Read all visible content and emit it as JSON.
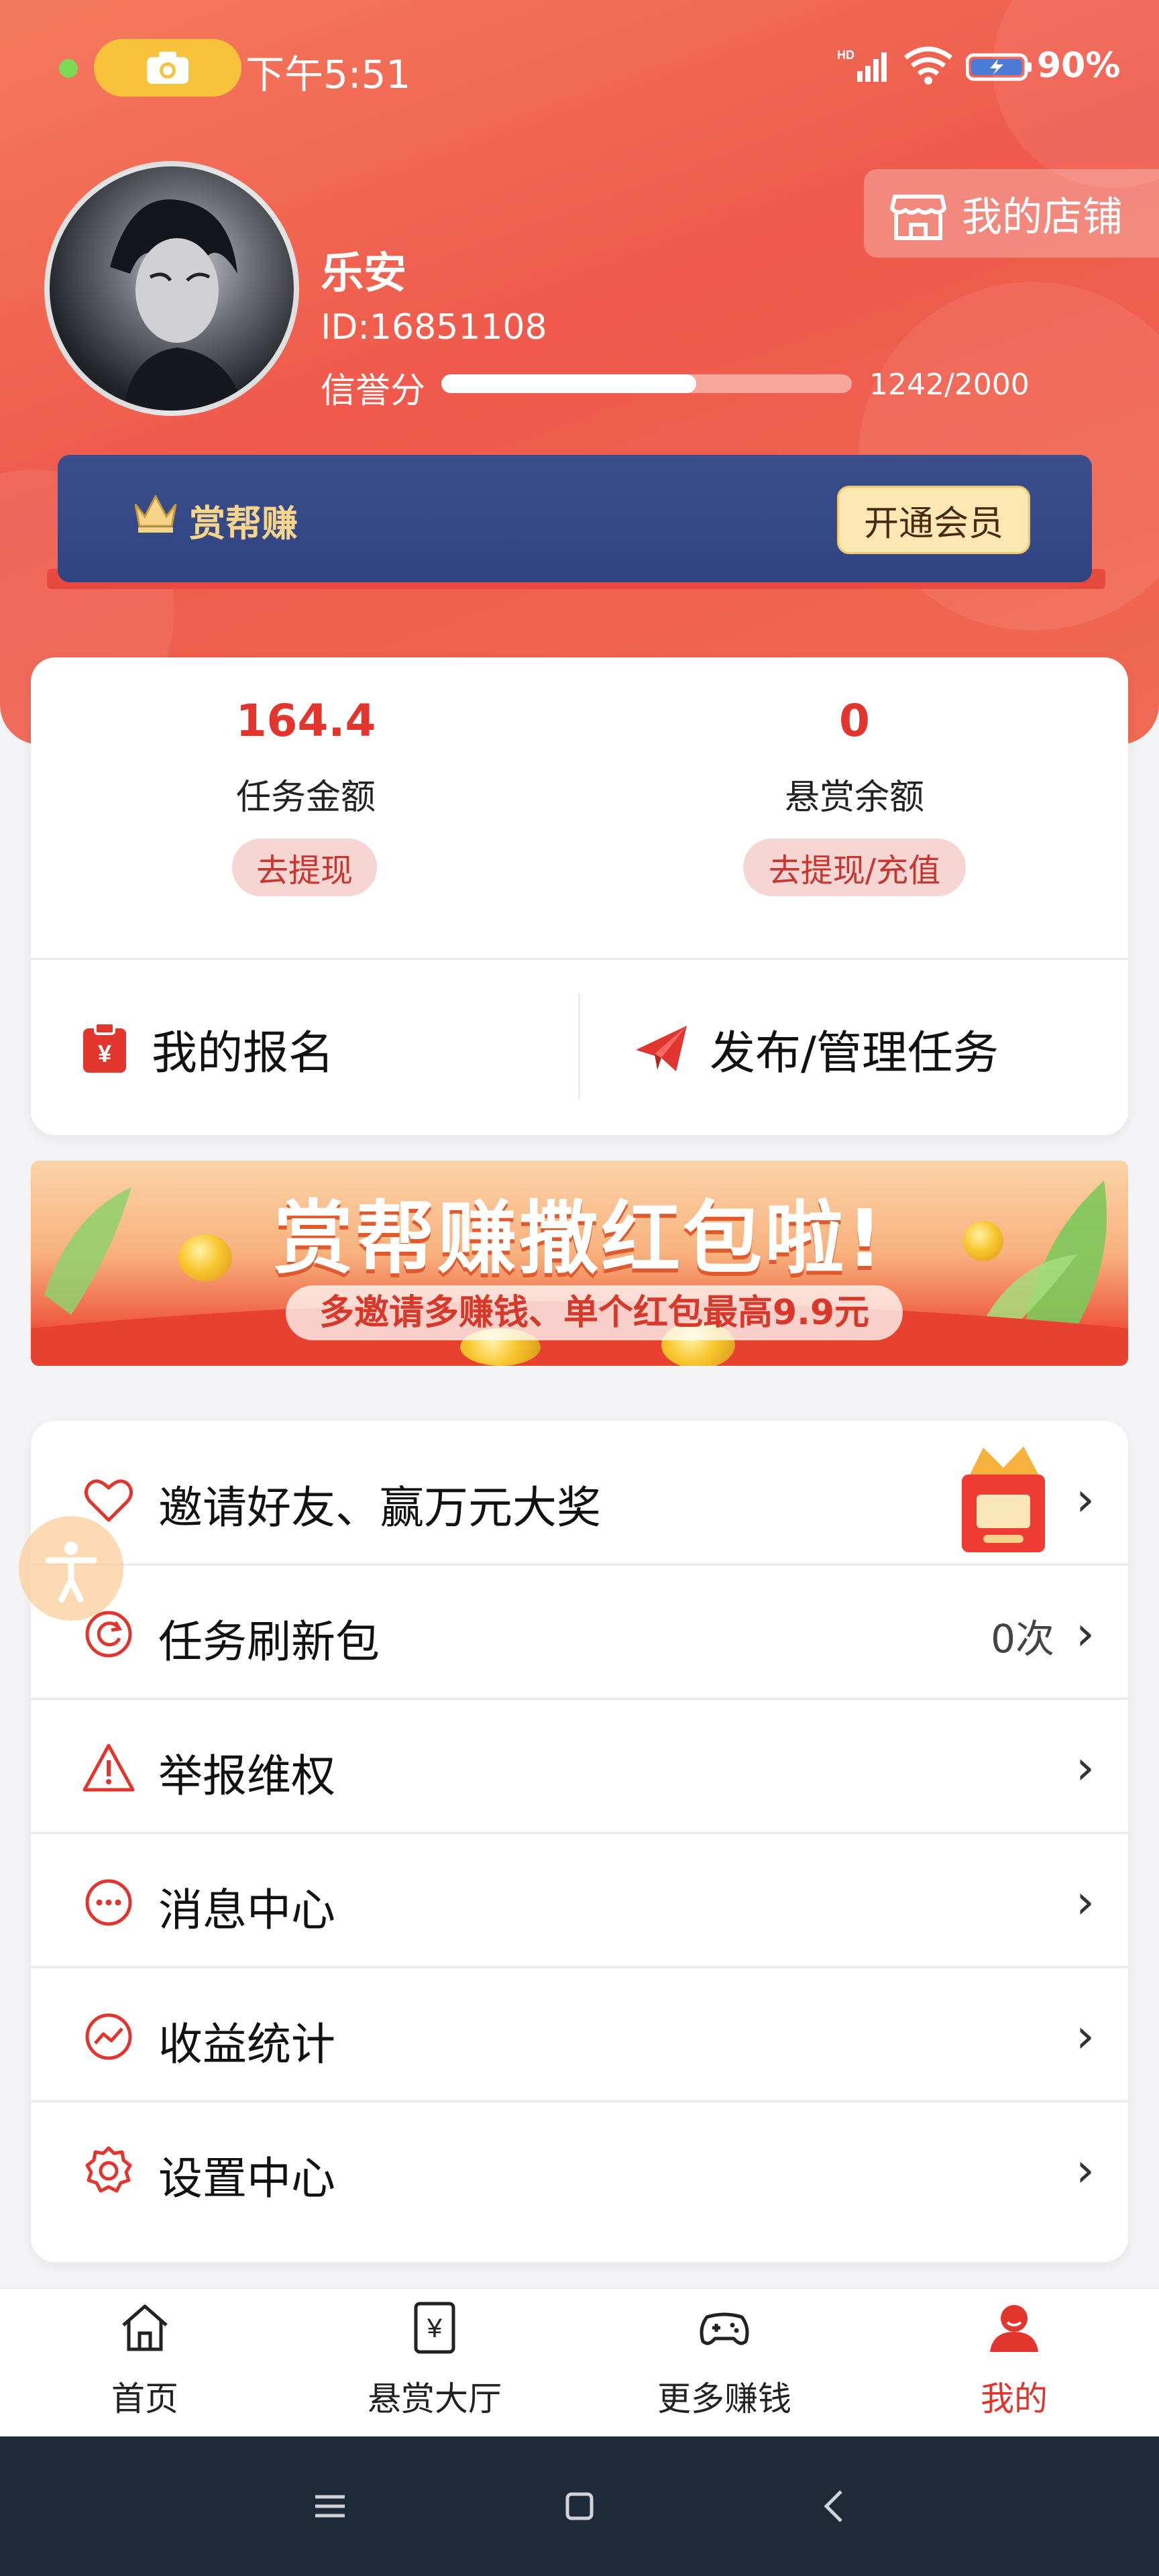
{
  "status_bar": {
    "time": "下午5:51",
    "network": "HD",
    "battery_pct": "90%"
  },
  "profile": {
    "name": "乐安",
    "id": "ID:16851108",
    "credit_label": "信誉分",
    "credit_value": "1242/2000",
    "credit_progress": 0.621,
    "shop_button": "我的店铺"
  },
  "vip": {
    "label": "赏帮赚",
    "button": "开通会员"
  },
  "wallet": {
    "task_amount": "164.4",
    "task_label": "任务金额",
    "task_action": "去提现",
    "reward_amount": "0",
    "reward_label": "悬赏余额",
    "reward_action": "去提现/充值"
  },
  "actions": {
    "my_signup": "我的报名",
    "publish_manage": "发布/管理任务"
  },
  "promo": {
    "title": "赏帮赚撒红包啦!",
    "subtitle": "多邀请多赚钱、单个红包最高9.9元"
  },
  "menu": [
    {
      "label": "邀请好友、赢万元大奖",
      "icon": "heart-icon",
      "extra": ""
    },
    {
      "label": "任务刷新包",
      "icon": "refresh-icon",
      "extra": "0次"
    },
    {
      "label": "举报维权",
      "icon": "warning-icon",
      "extra": ""
    },
    {
      "label": "消息中心",
      "icon": "message-icon",
      "extra": ""
    },
    {
      "label": "收益统计",
      "icon": "chart-icon",
      "extra": ""
    },
    {
      "label": "设置中心",
      "icon": "settings-icon",
      "extra": ""
    }
  ],
  "tabs": [
    {
      "label": "首页",
      "icon": "home-icon"
    },
    {
      "label": "悬赏大厅",
      "icon": "yuan-icon"
    },
    {
      "label": "更多赚钱",
      "icon": "gamepad-icon"
    },
    {
      "label": "我的",
      "icon": "user-icon"
    }
  ],
  "colors": {
    "accent": "#e1352d",
    "header": "#ef5a4c",
    "vip_bg": "#2f4480"
  }
}
